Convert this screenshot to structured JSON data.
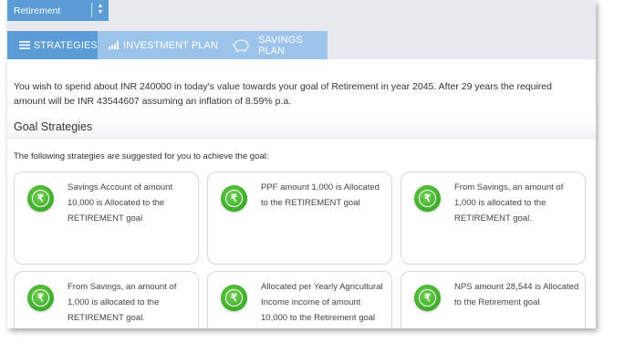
{
  "goal_select": {
    "value": "Retirement"
  },
  "tabs": [
    {
      "label": "STRATEGIES",
      "icon": "list-icon"
    },
    {
      "label": "INVESTMENT PLAN",
      "icon": "bar-chart-icon"
    },
    {
      "label": "SAVINGS PLAN",
      "icon": "piggy-bank-icon"
    }
  ],
  "summary": "You wish to spend about INR 240000 in today's value towards your goal of Retirement in year 2045. After 29 years the required amount will be INR 43544607 assuming an inflation of 8.59% p.a.",
  "section_title": "Goal Strategies",
  "intro": "The following strategies are suggested for you to achieve the goal:",
  "currency_symbol": "₹",
  "strategies": [
    "Savings Account of amount 10,000 is Allocated to the RETIREMENT goal",
    "PPF amount 1,000 is Allocated to the RETIREMENT goal",
    "From Savings, an amount of 1,000 is allocated to the RETIREMENT goal.",
    "From Savings, an amount of 1,000 is allocated to the RETIREMENT goal.",
    "Allocated per Yearly Agricultural Income income of amount 10,000 to the Retirement goal",
    "NPS amount 28,544 is Allocated to the Retirement goal"
  ],
  "colors": {
    "accent": "#5b9bd6",
    "tab_inactive": "#9cc3ea",
    "coin": "#3caa2a"
  }
}
